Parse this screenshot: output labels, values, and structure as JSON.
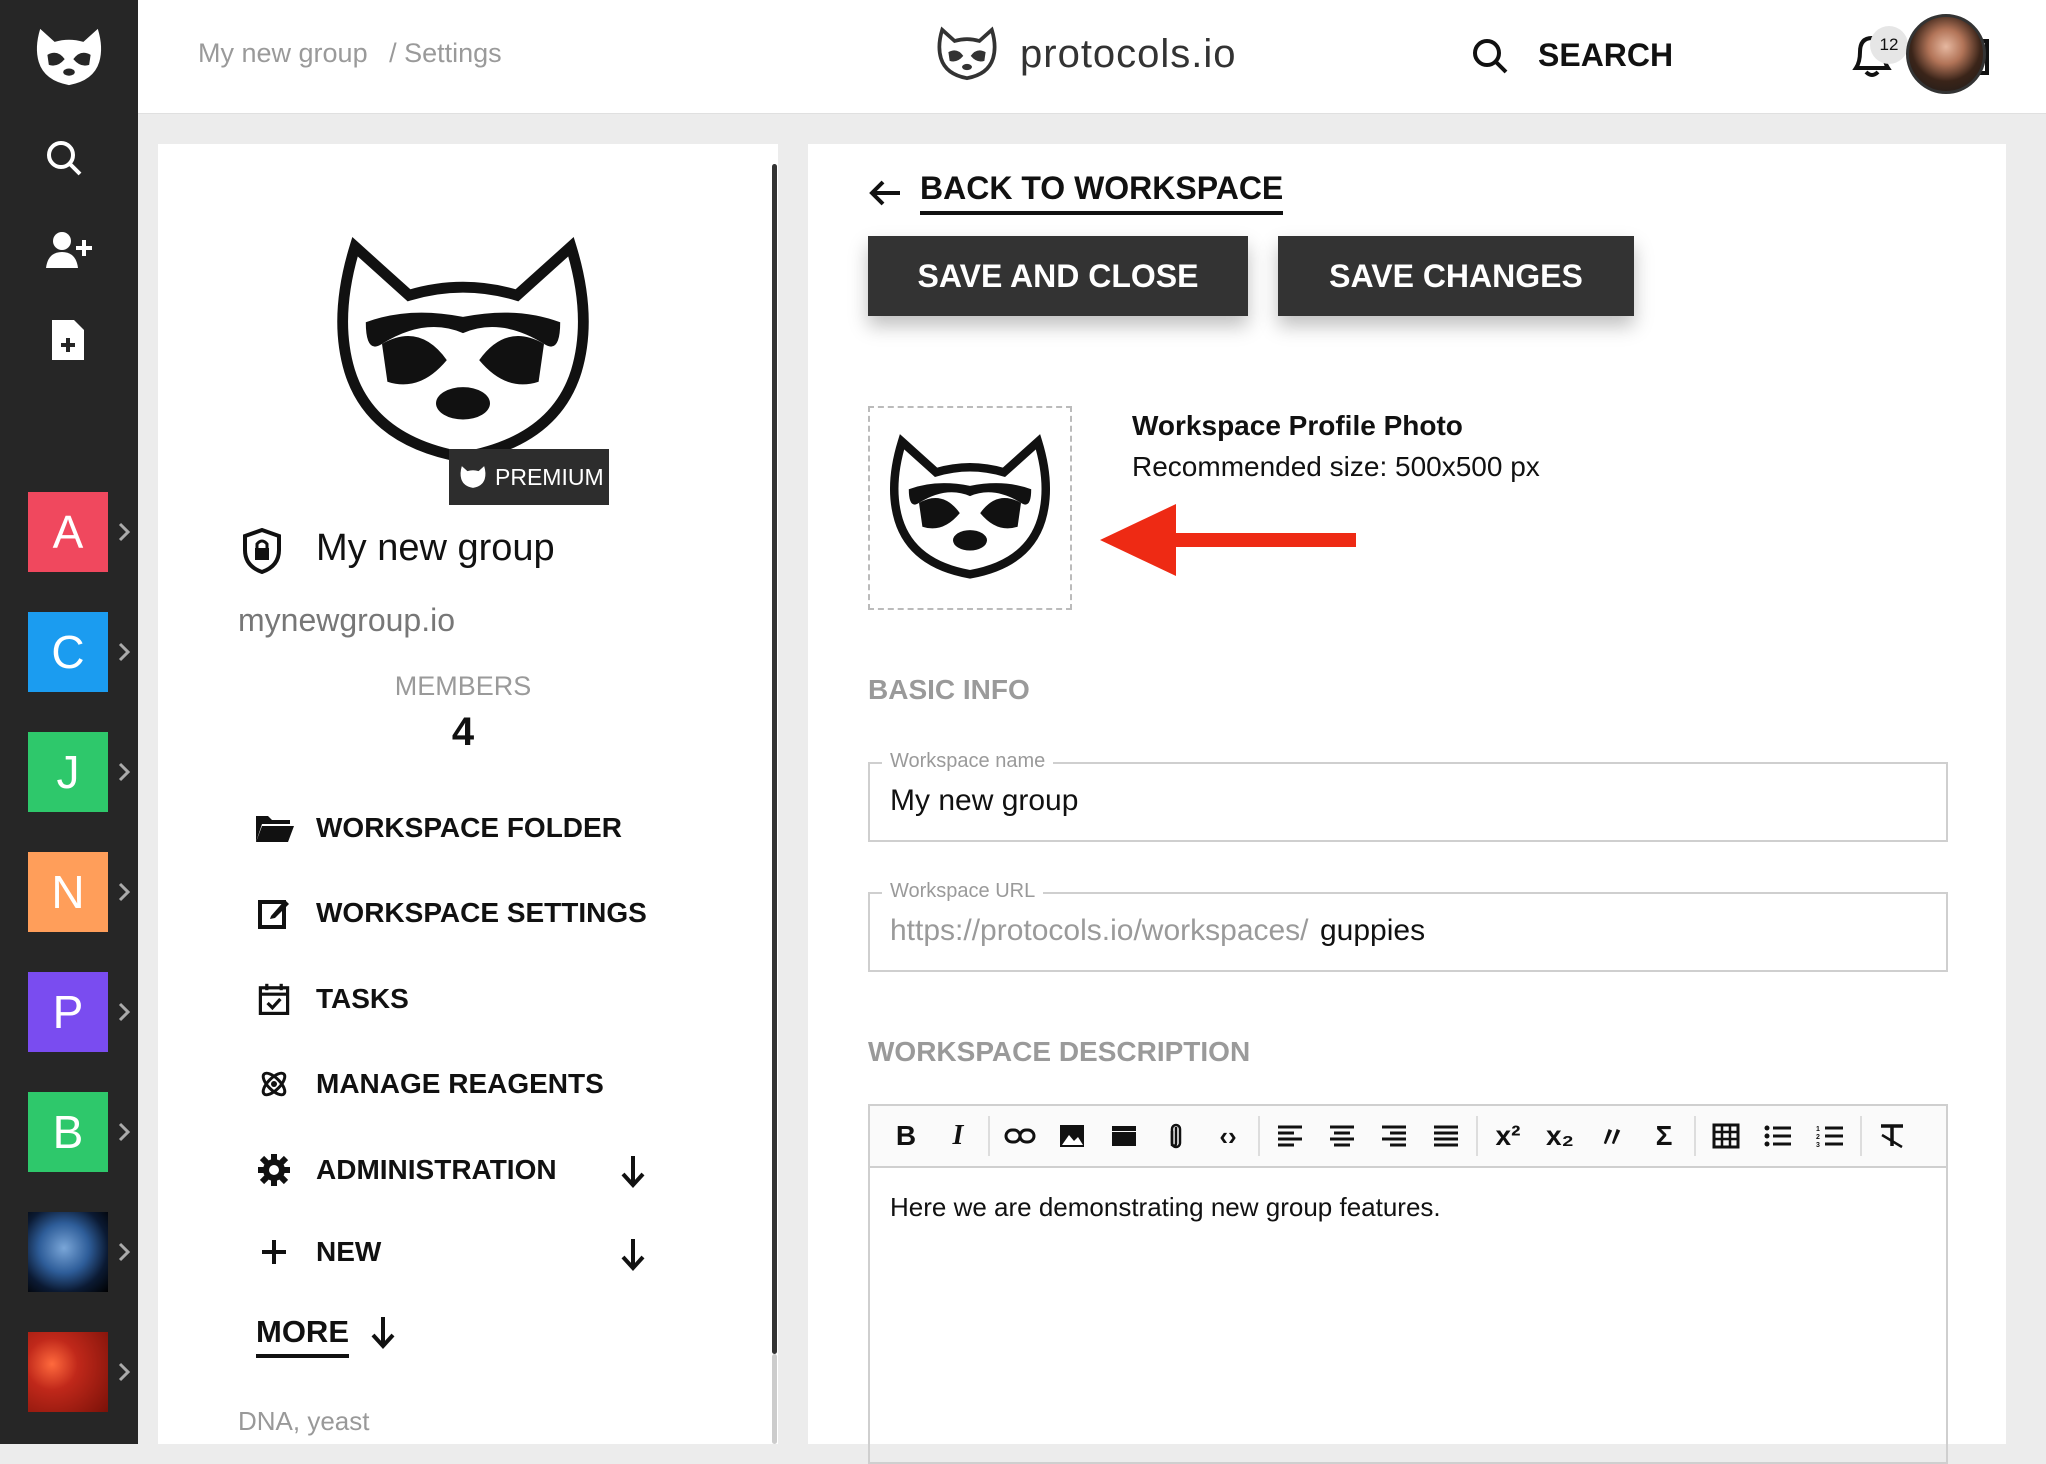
{
  "breadcrumb": {
    "group": "My new group",
    "sep": "/ Settings"
  },
  "brand": {
    "name": "protocols.io"
  },
  "header": {
    "search_label": "SEARCH",
    "notifications_count": "12"
  },
  "workspaces": [
    {
      "letter": "A",
      "color": "#f0485e"
    },
    {
      "letter": "C",
      "color": "#1b9cf0"
    },
    {
      "letter": "J",
      "color": "#2ec86b"
    },
    {
      "letter": "N",
      "color": "#ff9e5a"
    },
    {
      "letter": "P",
      "color": "#7a4cf0"
    },
    {
      "letter": "B",
      "color": "#2ec86b"
    }
  ],
  "group": {
    "badge": "PREMIUM",
    "name": "My new group",
    "url": "mynewgroup.io",
    "members_label": "MEMBERS",
    "members_count": "4"
  },
  "menu": {
    "folder": "WORKSPACE FOLDER",
    "settings": "WORKSPACE SETTINGS",
    "tasks": "TASKS",
    "reagents": "MANAGE REAGENTS",
    "administration": "ADMINISTRATION",
    "new": "NEW",
    "more": "MORE",
    "tags": "DNA, yeast"
  },
  "actions": {
    "back": "BACK TO WORKSPACE",
    "save_close": "SAVE AND CLOSE",
    "save_changes": "SAVE CHANGES"
  },
  "photo": {
    "title": "Workspace Profile Photo",
    "subtitle": "Recommended size: 500x500 px"
  },
  "basic_info": {
    "heading": "BASIC INFO",
    "name_label": "Workspace name",
    "name_value": "My new group",
    "url_label": "Workspace URL",
    "url_prefix": "https://protocols.io/workspaces/",
    "url_value": "guppies"
  },
  "description": {
    "heading": "WORKSPACE DESCRIPTION",
    "text": "Here we are demonstrating new group features."
  }
}
